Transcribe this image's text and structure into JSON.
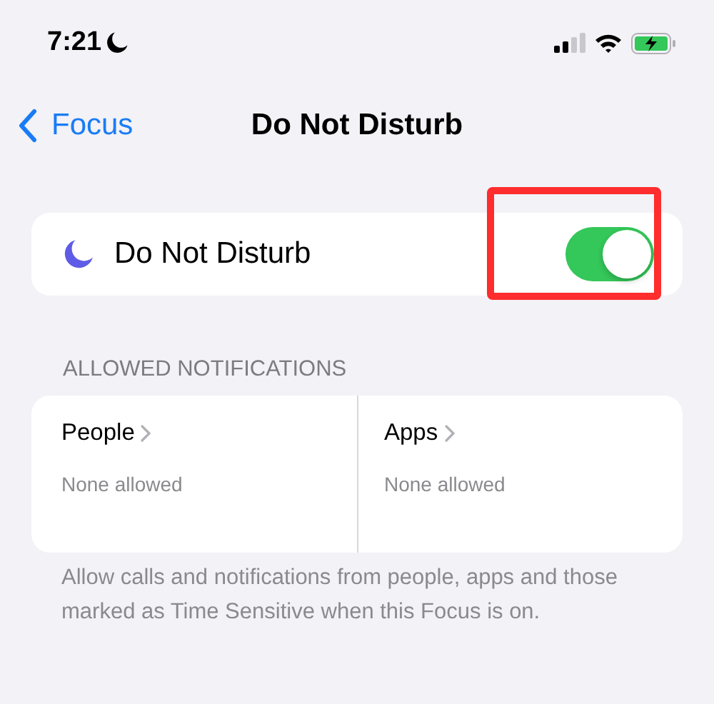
{
  "status_bar": {
    "time": "7:21",
    "focus_on": true
  },
  "nav": {
    "back": "Focus",
    "title": "Do Not Disturb"
  },
  "focus_row": {
    "label": "Do Not Disturb",
    "on": true,
    "highlighted": true
  },
  "section": {
    "header": "ALLOWED NOTIFICATIONS",
    "items": [
      {
        "label": "People",
        "value": "None allowed"
      },
      {
        "label": "Apps",
        "value": "None allowed"
      }
    ],
    "footer": "Allow calls and notifications from people, apps and those marked as Time Sensitive when this Focus is on."
  }
}
